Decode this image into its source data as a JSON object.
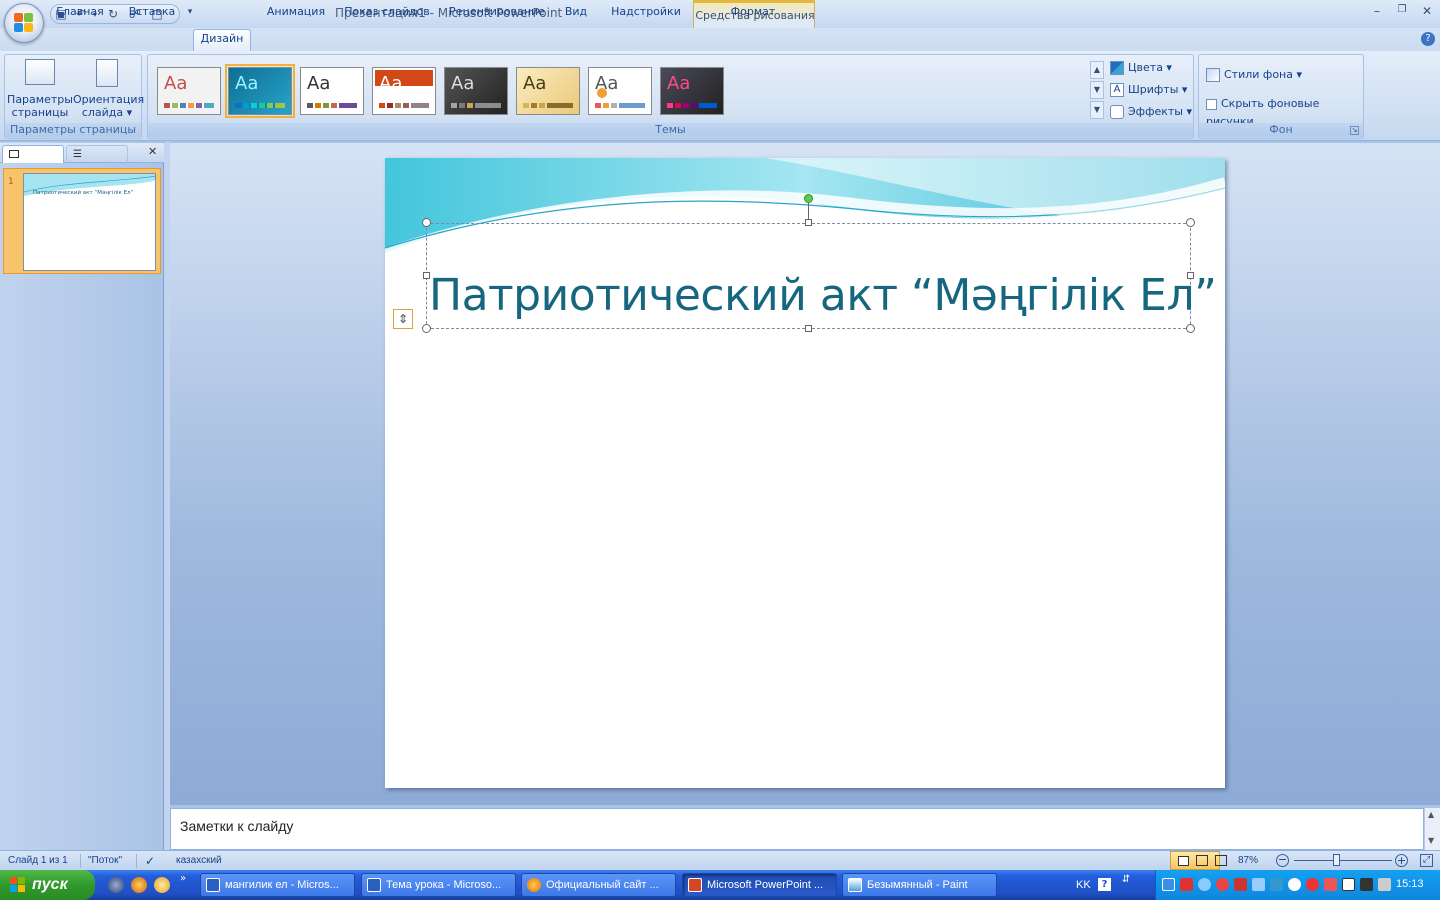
{
  "window": {
    "title": "Презентация1 - Microsoft PowerPoint",
    "context_group": "Средства рисования"
  },
  "tabs": [
    "Главная",
    "Вставка",
    "Дизайн",
    "Анимация",
    "Показ слайдов",
    "Рецензирование",
    "Вид",
    "Надстройки",
    "Формат"
  ],
  "active_tab": "Дизайн",
  "ribbon": {
    "page_setup": {
      "group_label": "Параметры страницы",
      "page_params": "Параметры\nстраницы",
      "page_params_l1": "Параметры",
      "page_params_l2": "страницы",
      "orientation_l1": "Ориентация",
      "orientation_l2": "слайда ▾"
    },
    "themes": {
      "group_label": "Темы",
      "items": [
        {
          "label": "Aa",
          "bg": "#f4f4f4",
          "fg": "#c0504d"
        },
        {
          "label": "Aa",
          "bg": "#1b7fa6",
          "fg": "#8ee5ff"
        },
        {
          "label": "Aa",
          "bg": "#ffffff",
          "fg": "#444444"
        },
        {
          "label": "Aa",
          "bg": "#ffffff",
          "fg": "#ffffff"
        },
        {
          "label": "Aa",
          "bg": "#3a3a3a",
          "fg": "#dcdcdc"
        },
        {
          "label": "Aa",
          "bg": "#f6e3a8",
          "fg": "#5a4a20"
        },
        {
          "label": "Aa",
          "bg": "#ffffff",
          "fg": "#555555"
        },
        {
          "label": "Aa",
          "bg": "#3b3b48",
          "fg": "#e0447a"
        }
      ],
      "colors": "Цвета ▾",
      "fonts": "Шрифты ▾",
      "effects": "Эффекты ▾"
    },
    "background": {
      "group_label": "Фон",
      "styles": "Стили фона ▾",
      "hide_graphics": "Скрыть фоновые рисунки"
    }
  },
  "slide": {
    "number": "1",
    "title": "Патриотический акт “Мәңгілік Ел”",
    "thumb_title": "Патриотический акт “Мәңгілік Ел”"
  },
  "notes": {
    "placeholder": "Заметки к слайду"
  },
  "status": {
    "slide_info": "Слайд 1 из 1",
    "theme": "\"Поток\"",
    "language": "казахский",
    "zoom": "87%"
  },
  "taskbar": {
    "start": "пуск",
    "items": [
      {
        "label": "мангилик ел - Micros...",
        "color": "#2a5fbf"
      },
      {
        "label": "Тема урока - Microso...",
        "color": "#2a5fbf"
      },
      {
        "label": "Официальный сайт ...",
        "color": "#e76f1c"
      },
      {
        "label": "Microsoft PowerPoint ...",
        "color": "#d24726"
      },
      {
        "label": "Безымянный - Paint",
        "color": "#4aa0e0"
      }
    ],
    "lang": "KK",
    "clock": "15:13"
  }
}
